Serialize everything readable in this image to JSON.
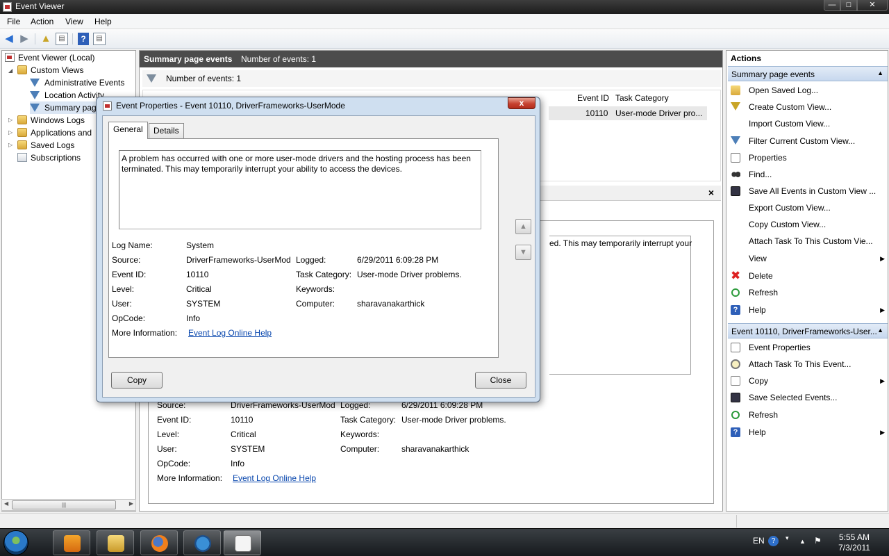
{
  "window": {
    "title": "Event Viewer"
  },
  "menu": [
    "File",
    "Action",
    "View",
    "Help"
  ],
  "tree": {
    "root": "Event Viewer (Local)",
    "custom_views": "Custom Views",
    "admin_events": "Administrative Events",
    "location_activity": "Location Activity",
    "summary_page": "Summary pag",
    "windows_logs": "Windows Logs",
    "apps_services": "Applications and",
    "saved_logs": "Saved Logs",
    "subscriptions": "Subscriptions"
  },
  "center": {
    "header_title": "Summary page events",
    "header_count": "Number of events: 1",
    "filter_text": "Number of events: 1",
    "columns": {
      "event_id": "Event ID",
      "task_category": "Task Category"
    },
    "row": {
      "event_id": "10110",
      "task_category": "User-mode Driver pro..."
    },
    "detail_close": "×",
    "bg_message": "ed.  This may temporarily interrupt your",
    "bg_fields": {
      "source_label": "Source:",
      "source_value": "DriverFrameworks-UserMod",
      "logged_label": "Logged:",
      "logged_value": "6/29/2011 6:09:28 PM",
      "eventid_label": "Event ID:",
      "eventid_value": "10110",
      "task_label": "Task Category:",
      "task_value": "User-mode Driver problems.",
      "level_label": "Level:",
      "level_value": "Critical",
      "keywords_label": "Keywords:",
      "user_label": "User:",
      "user_value": "SYSTEM",
      "computer_label": "Computer:",
      "computer_value": "sharavanakarthick",
      "opcode_label": "OpCode:",
      "opcode_value": "Info",
      "moreinfo_label": "More Information:",
      "moreinfo_link": "Event Log Online Help"
    }
  },
  "actions": {
    "title": "Actions",
    "section1": "Summary page events",
    "items1": [
      "Open Saved Log...",
      "Create Custom View...",
      "Import Custom View...",
      "Filter Current Custom View...",
      "Properties",
      "Find...",
      "Save All Events in Custom View ...",
      "Export Custom View...",
      "Copy Custom View...",
      "Attach Task To This Custom Vie...",
      "View",
      "Delete",
      "Refresh",
      "Help"
    ],
    "section2": "Event 10110, DriverFrameworks-User...",
    "items2": [
      "Event Properties",
      "Attach Task To This Event...",
      "Copy",
      "Save Selected Events...",
      "Refresh",
      "Help"
    ]
  },
  "dialog": {
    "title": "Event Properties - Event 10110, DriverFrameworks-UserMode",
    "close_glyph": "x",
    "tabs": {
      "general": "General",
      "details": "Details"
    },
    "message": "A problem has occurred with one or more user-mode drivers and the hosting process has been terminated.  This may temporarily interrupt your ability to access the devices.",
    "fields": {
      "logname_label": "Log Name:",
      "logname_value": "System",
      "source_label": "Source:",
      "source_value": "DriverFrameworks-UserMod",
      "logged_label": "Logged:",
      "logged_value": "6/29/2011 6:09:28 PM",
      "eventid_label": "Event ID:",
      "eventid_value": "10110",
      "task_label": "Task Category:",
      "task_value": "User-mode Driver problems.",
      "level_label": "Level:",
      "level_value": "Critical",
      "keywords_label": "Keywords:",
      "user_label": "User:",
      "user_value": "SYSTEM",
      "computer_label": "Computer:",
      "computer_value": "sharavanakarthick",
      "opcode_label": "OpCode:",
      "opcode_value": "Info",
      "moreinfo_label": "More Information:",
      "moreinfo_link": "Event Log Online Help"
    },
    "copy_button": "Copy",
    "close_button": "Close"
  },
  "taskbar": {
    "language": "EN",
    "time": "5:55 AM",
    "date": "7/3/2011"
  }
}
